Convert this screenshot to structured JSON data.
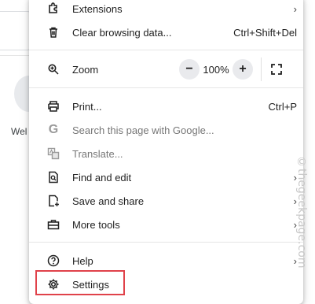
{
  "background": {
    "partial_label": "Wel"
  },
  "menu": {
    "extensions": {
      "label": "Extensions",
      "chevron": "›"
    },
    "clear_data": {
      "label": "Clear browsing data...",
      "shortcut": "Ctrl+Shift+Del"
    },
    "zoom": {
      "label": "Zoom",
      "minus": "−",
      "value": "100%",
      "plus": "+"
    },
    "print": {
      "label": "Print...",
      "shortcut": "Ctrl+P"
    },
    "search_google": {
      "label": "Search this page with Google..."
    },
    "translate": {
      "label": "Translate..."
    },
    "find_edit": {
      "label": "Find and edit",
      "chevron": "›"
    },
    "save_share": {
      "label": "Save and share",
      "chevron": "›"
    },
    "more_tools": {
      "label": "More tools",
      "chevron": "›"
    },
    "help": {
      "label": "Help",
      "chevron": "›"
    },
    "settings": {
      "label": "Settings"
    }
  },
  "watermark": "©thegeekpage.com",
  "colors": {
    "highlight": "#e0424a",
    "disabled_text": "#777777"
  }
}
